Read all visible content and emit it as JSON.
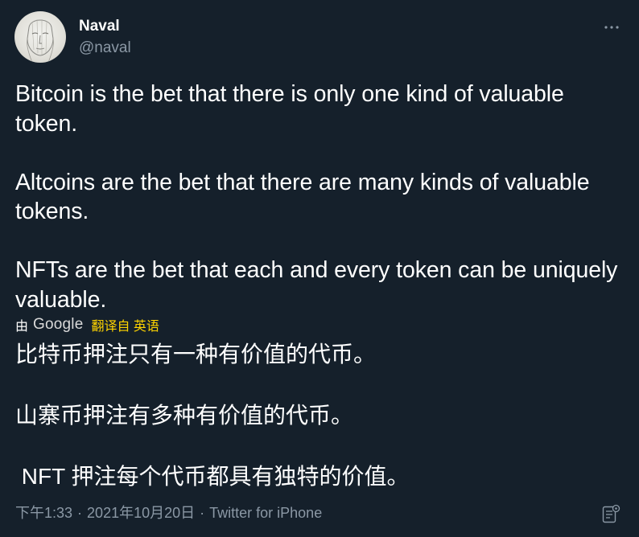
{
  "author": {
    "name": "Naval",
    "handle": "@naval",
    "avatar": "sketch-portrait-avatar"
  },
  "menu_icon": "more-horizontal-icon",
  "tweet": {
    "paragraphs": [
      "Bitcoin is the bet that there is only one kind of valuable token.",
      "Altcoins are the bet that there are many kinds of valuable tokens.",
      "NFTs are the bet that each and every token can be uniquely valuable."
    ]
  },
  "translation": {
    "by_label": "由",
    "provider": "Google",
    "link_label": "翻译自 英语",
    "paragraphs": [
      "比特币押注只有一种有价值的代币。",
      "山寨币押注有多种有价值的代币。",
      " NFT 押注每个代币都具有独特的价值。"
    ]
  },
  "meta": {
    "time": "下午1:33",
    "separator": "·",
    "date": "2021年10月20日",
    "source": "Twitter for iPhone"
  },
  "corner_icon": "note-settings-icon",
  "colors": {
    "background": "#15202b",
    "text": "#ffffff",
    "secondary_text": "#8b98a5",
    "translate_link": "#ffd400"
  }
}
